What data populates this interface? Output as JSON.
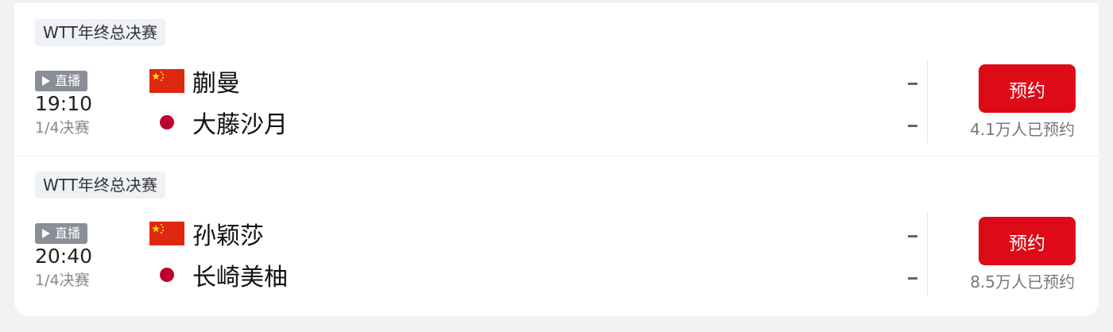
{
  "colors": {
    "reserve_button": "#dd0a17",
    "live_badge": "#8a8e96",
    "tag_bg": "#eef1f5",
    "china_flag": "#de2910",
    "japan_dot": "#bc002d"
  },
  "matches": [
    {
      "event_tag": "WTT年终总决赛",
      "live_label": "直播",
      "time": "19:10",
      "stage": "1/4决赛",
      "players": [
        {
          "name": "蒯曼",
          "flag_icon": "china-flag-icon",
          "score": "-"
        },
        {
          "name": "大藤沙月",
          "flag_icon": "japan-flag-icon",
          "score": "-"
        }
      ],
      "reserve_label": "预约",
      "reserve_count": "4.1万人已预约"
    },
    {
      "event_tag": "WTT年终总决赛",
      "live_label": "直播",
      "time": "20:40",
      "stage": "1/4决赛",
      "players": [
        {
          "name": "孙颖莎",
          "flag_icon": "china-flag-icon",
          "score": "-"
        },
        {
          "name": "长崎美柚",
          "flag_icon": "japan-flag-icon",
          "score": "-"
        }
      ],
      "reserve_label": "预约",
      "reserve_count": "8.5万人已预约"
    }
  ]
}
